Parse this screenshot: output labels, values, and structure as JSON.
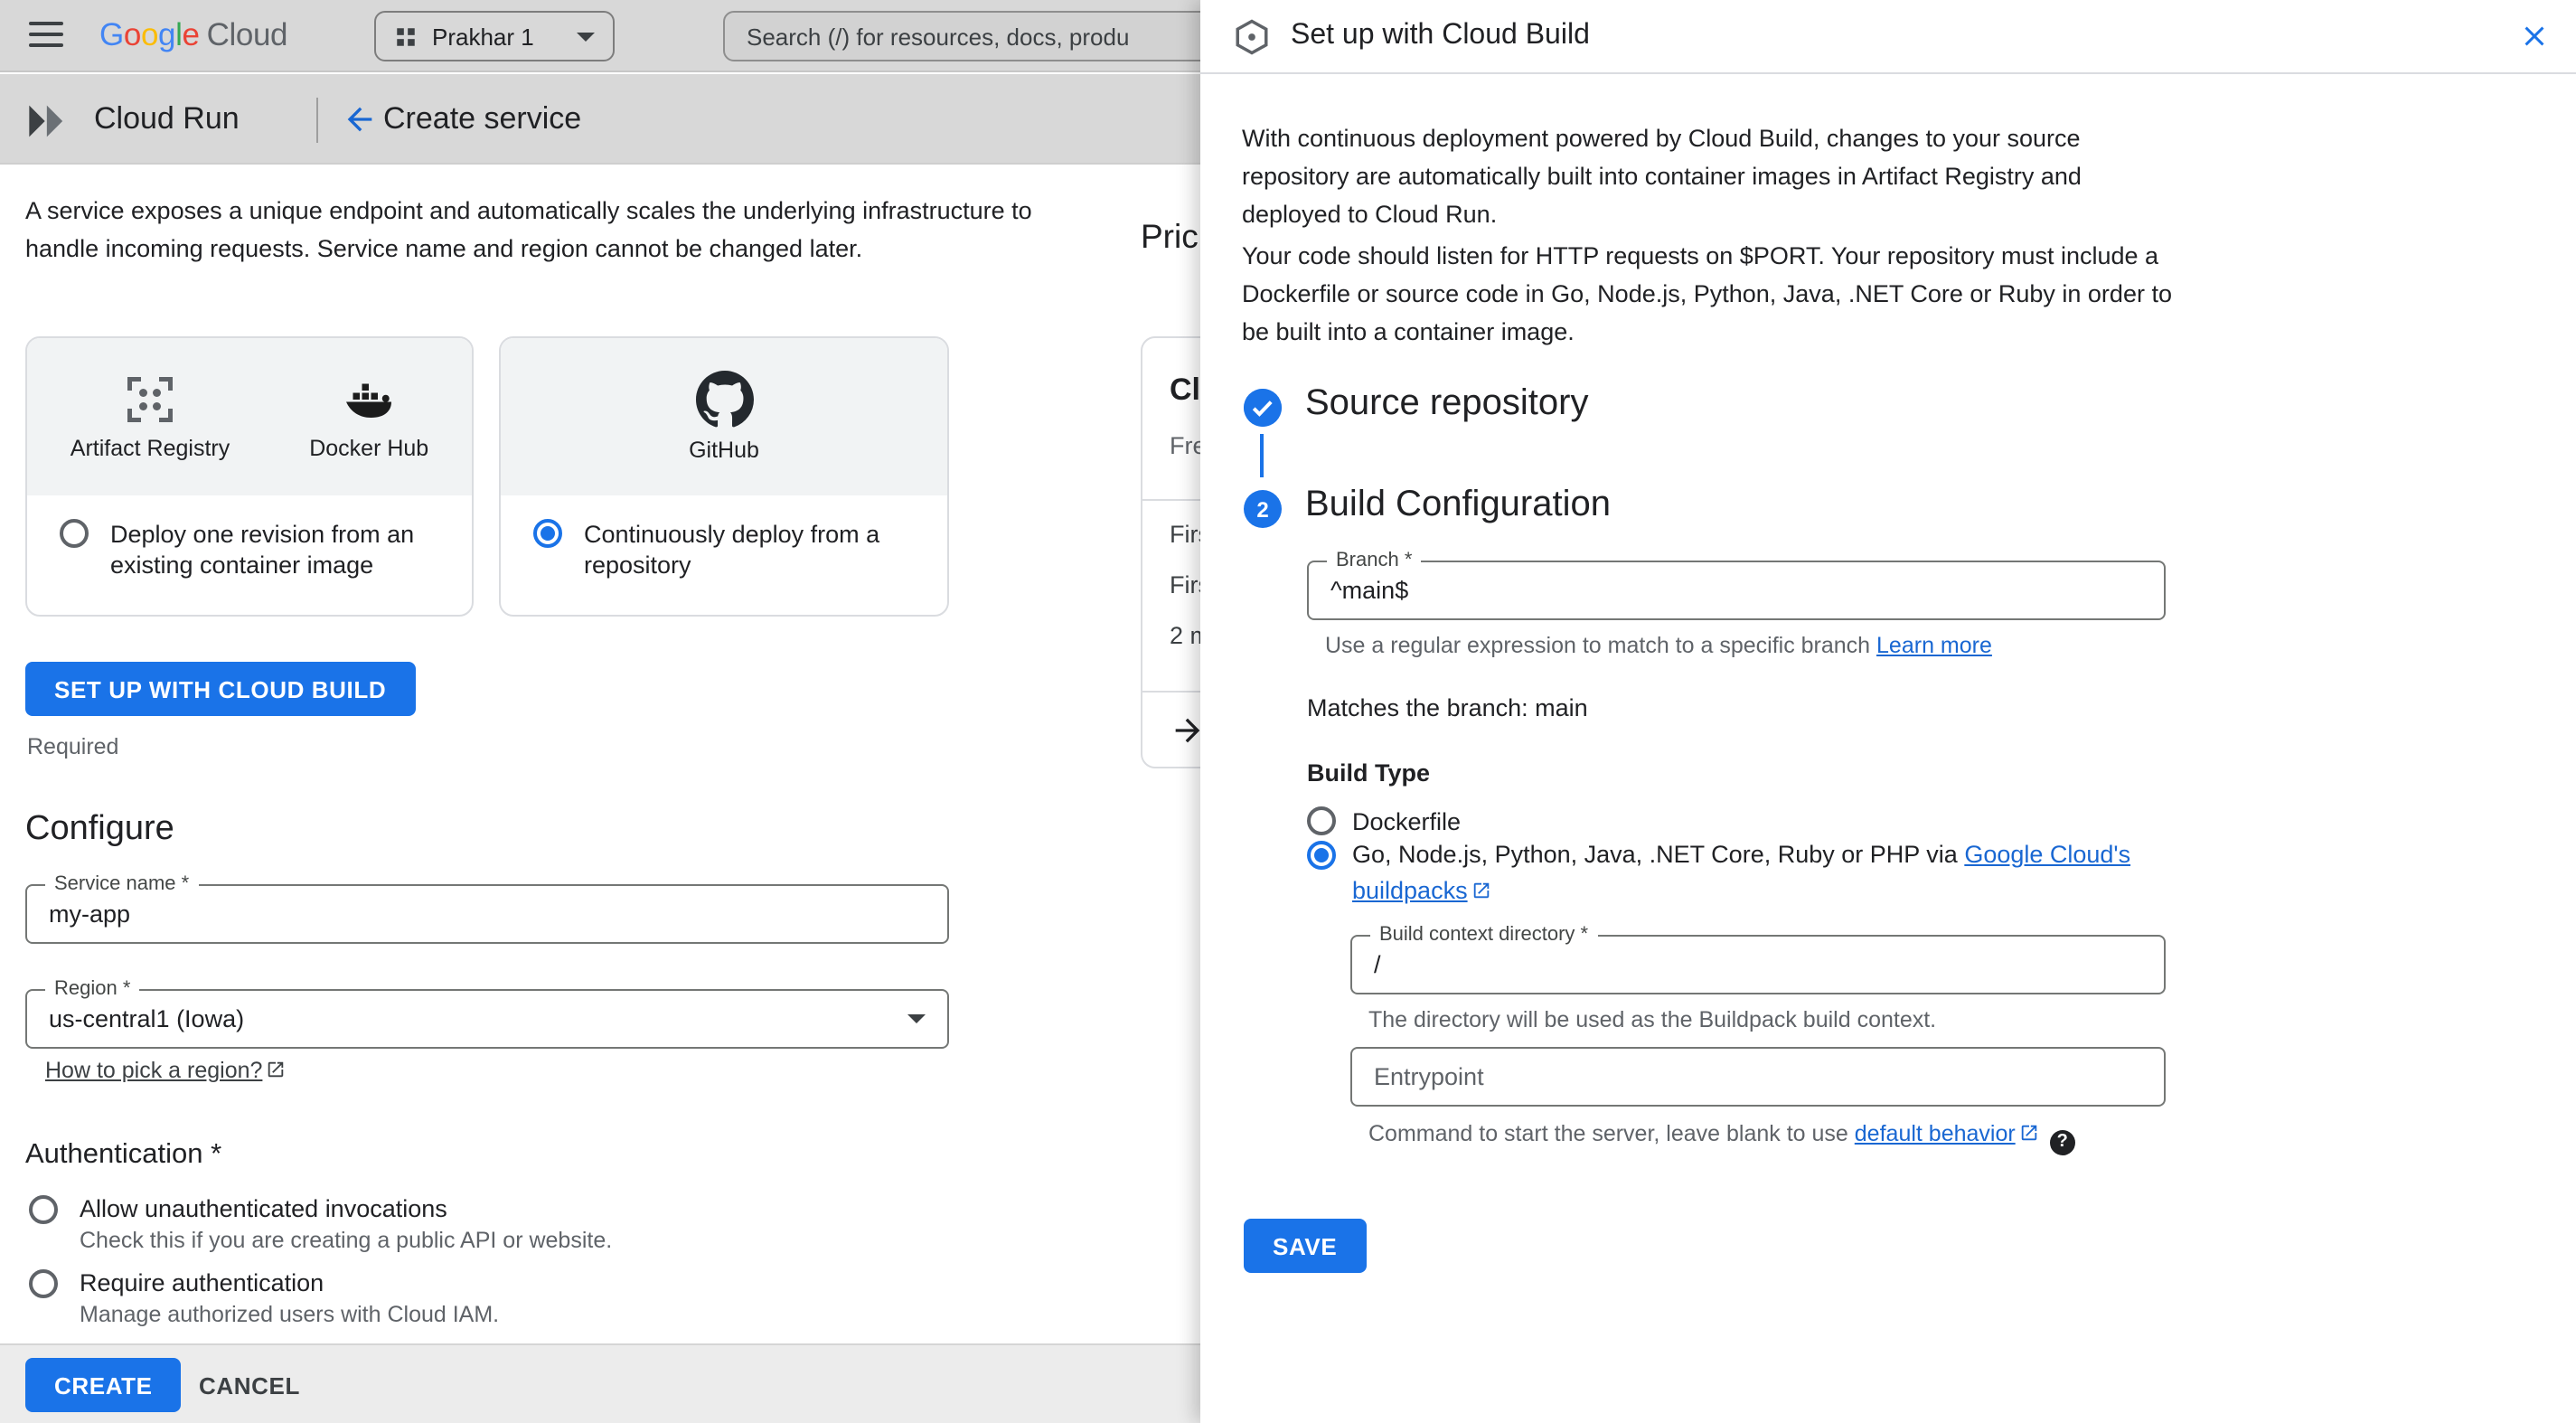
{
  "topbar": {
    "google": "Google",
    "cloud": "Cloud",
    "project": "Prakhar 1",
    "search_placeholder": "Search (/) for resources, docs, produ"
  },
  "toolbar": {
    "product": "Cloud Run",
    "page_title": "Create service"
  },
  "intro": "A service exposes a unique endpoint and automatically scales the underlying infrastructure to handle incoming requests. Service name and region cannot be changed later.",
  "source_cards": {
    "artifact_registry": "Artifact Registry",
    "docker_hub": "Docker Hub",
    "github": "GitHub",
    "deploy_existing": "Deploy one revision from an existing container image",
    "deploy_repo": "Continuously deploy from a repository"
  },
  "setup_button": "SET UP WITH CLOUD BUILD",
  "required_note": "Required",
  "configure": {
    "heading": "Configure",
    "service_name_label": "Service name *",
    "service_name_value": "my-app",
    "region_label": "Region *",
    "region_value": "us-central1 (Iowa)",
    "region_link": "How to pick a region?"
  },
  "authentication": {
    "heading": "Authentication *",
    "allow_label": "Allow unauthenticated invocations",
    "allow_desc": "Check this if you are creating a public API or website.",
    "require_label": "Require authentication",
    "require_desc": "Manage authorized users with Cloud IAM."
  },
  "footer": {
    "create": "CREATE",
    "cancel": "CANCEL"
  },
  "pricing": {
    "heading": "Pric",
    "line1": "Cl",
    "line2": "Fre",
    "line3": "Firs",
    "line4": "Firs",
    "line5": "2 m"
  },
  "panel": {
    "title": "Set up with Cloud Build",
    "intro1": "With continuous deployment powered by Cloud Build, changes to your source repository are automatically built into container images in Artifact Registry and deployed to Cloud Run.",
    "intro2": "Your code should listen for HTTP requests on $PORT. Your repository must include a Dockerfile or source code in Go, Node.js, Python, Java, .NET Core or Ruby in order to be built into a container image.",
    "step1_title": "Source repository",
    "step2_number": "2",
    "step2_title": "Build Configuration",
    "branch_label": "Branch *",
    "branch_value": "^main$",
    "branch_helper": "Use a regular expression to match to a specific branch ",
    "branch_helper_link": "Learn more",
    "matches_text": "Matches the branch: main",
    "build_type_label": "Build Type",
    "dockerfile_option": "Dockerfile",
    "buildpacks_prefix": "Go, Node.js, Python, Java, .NET Core, Ruby or PHP via ",
    "buildpacks_link": "Google Cloud's buildpacks",
    "context_label": "Build context directory *",
    "context_value": "/",
    "context_helper": "The directory will be used as the Buildpack build context.",
    "entrypoint_placeholder": "Entrypoint",
    "entrypoint_helper": "Command to start the server, leave blank to use ",
    "entrypoint_helper_link": "default behavior",
    "save": "SAVE"
  }
}
